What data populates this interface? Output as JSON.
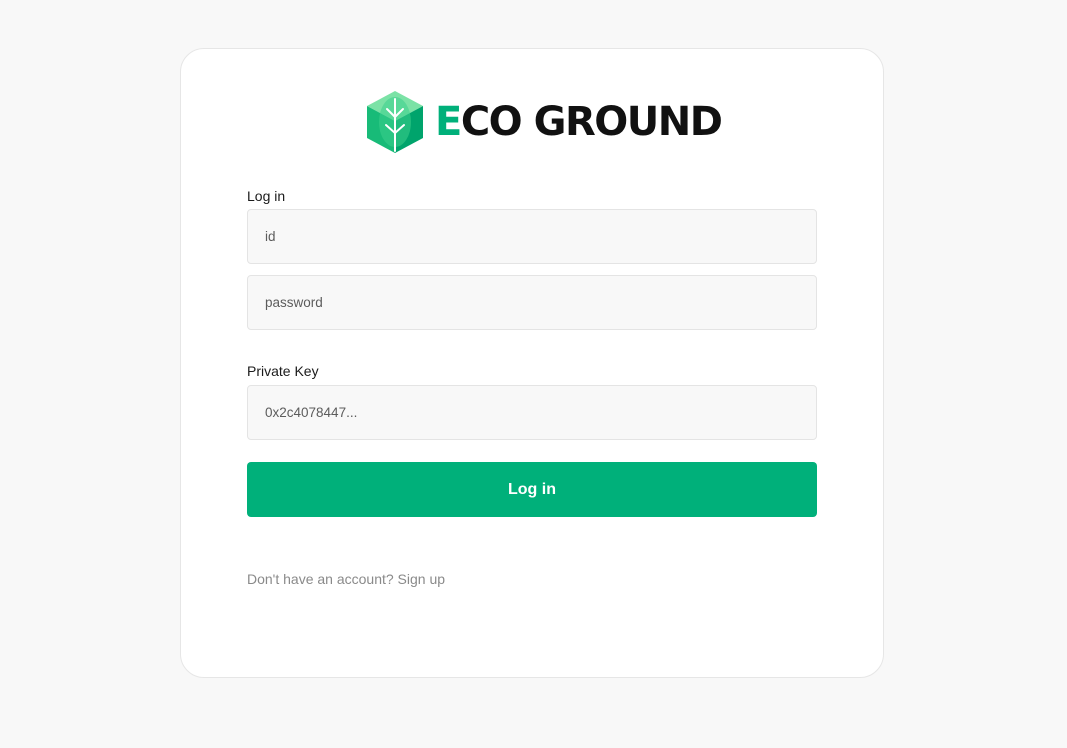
{
  "logo": {
    "brand_accent_letter": "E",
    "brand_rest": "CO GROUND",
    "icon": "eco-cube-leaf-icon"
  },
  "login": {
    "section_label": "Log in",
    "id_placeholder": "id",
    "password_placeholder": "password"
  },
  "private_key": {
    "section_label": "Private Key",
    "placeholder": "0x2c4078447..."
  },
  "submit_label": "Log in",
  "signup_text": "Don't have an account? Sign up",
  "colors": {
    "accent": "#00b07a",
    "page_background": "#f8f8f8",
    "field_background": "#f8f8f8",
    "text_dark": "#111111",
    "text_muted": "#8a8a8a"
  }
}
